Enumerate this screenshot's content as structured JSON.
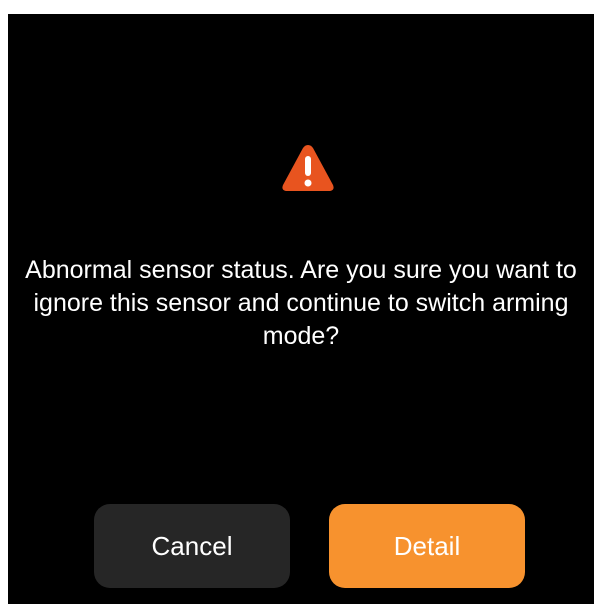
{
  "dialog": {
    "icon": "warning-icon",
    "message": "Abnormal sensor status. Are you sure you want to ignore this sensor and continue to switch arming mode?",
    "cancel_label": "Cancel",
    "detail_label": "Detail"
  },
  "colors": {
    "background": "#000000",
    "warning": "#e8541f",
    "cancel_button": "#262626",
    "detail_button": "#f7922e",
    "text": "#ffffff"
  }
}
